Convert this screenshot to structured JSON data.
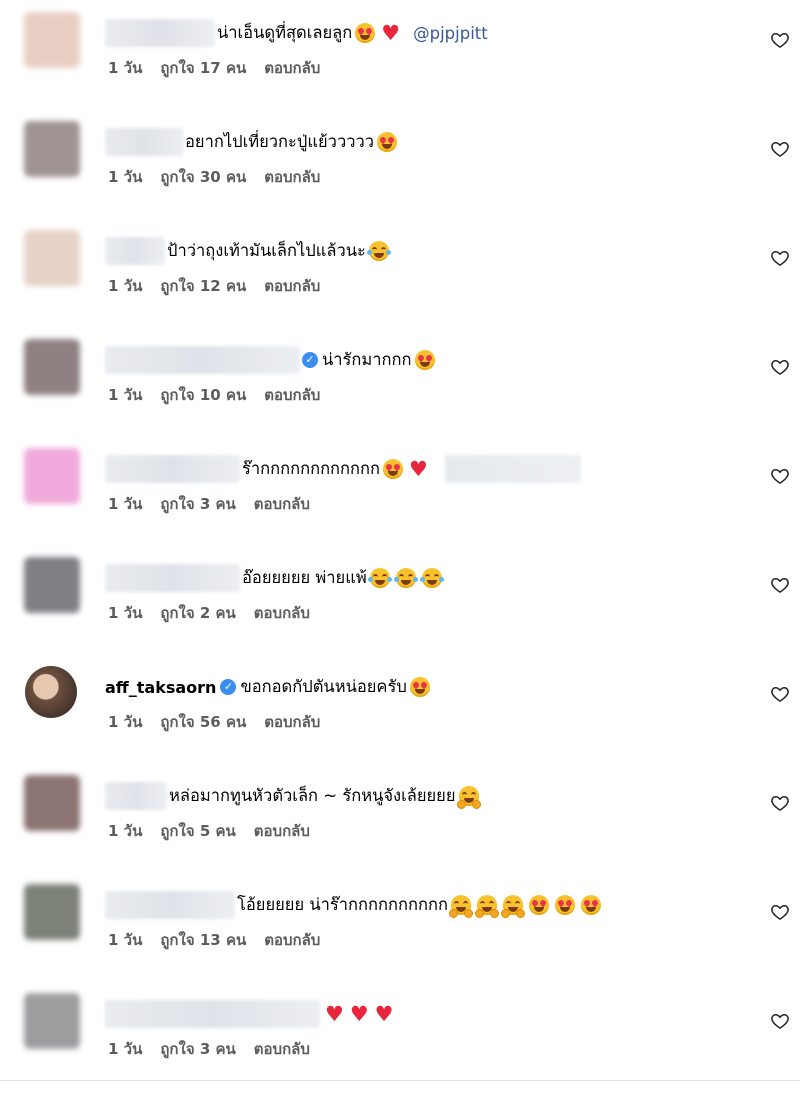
{
  "comments": [
    {
      "text": "น่าเอ็นดูที่สุดเลยลูก",
      "emojis": [
        "heart-eyes",
        "red-heart"
      ],
      "mention": "@pjpjpitt",
      "time": "1 วัน",
      "likes": "ถูกใจ 17 คน",
      "reply": "ตอบกลับ",
      "avatar_color": "#e9cfc3"
    },
    {
      "text": "อยากไปเที่ยวกะปู่แย้ววววว",
      "emojis": [
        "heart-eyes"
      ],
      "time": "1 วัน",
      "likes": "ถูกใจ 30 คน",
      "reply": "ตอบกลับ",
      "avatar_color": "#9f9491"
    },
    {
      "text": "ป้าว่าถุงเท้ามันเล็กไปแล้วนะ",
      "emojis": [
        "tears-of-joy"
      ],
      "time": "1 วัน",
      "likes": "ถูกใจ 12 คน",
      "reply": "ตอบกลับ",
      "avatar_color": "#e6d2c6"
    },
    {
      "text": "น่ารักมากกก",
      "emojis": [
        "heart-eyes"
      ],
      "verified": true,
      "time": "1 วัน",
      "likes": "ถูกใจ 10 คน",
      "reply": "ตอบกลับ",
      "avatar_color": "#8f8182"
    },
    {
      "text": "ร๊ากกกกกกกกกกกก",
      "emojis": [
        "heart-eyes",
        "red-heart"
      ],
      "tag_blur": true,
      "time": "1 วัน",
      "likes": "ถูกใจ 3 คน",
      "reply": "ตอบกลับ",
      "avatar_color": "#f0a9da"
    },
    {
      "text": "อ๊อยยยยย พ่ายแพ้",
      "emojis": [
        "tears-of-joy",
        "tears-of-joy",
        "tears-of-joy"
      ],
      "time": "1 วัน",
      "likes": "ถูกใจ 2 คน",
      "reply": "ตอบกลับ",
      "avatar_color": "#7f7f85"
    },
    {
      "username": "aff_taksaorn",
      "verified": true,
      "text": "ขอกอดกัปตันหน่อยครับ",
      "emojis": [
        "heart-eyes"
      ],
      "time": "1 วัน",
      "likes": "ถูกใจ 56 คน",
      "reply": "ตอบกลับ",
      "avatar_color": "#6b4f3e"
    },
    {
      "text": "หล่อมากทูนหัวตัวเล็ก ~ รักหนูจังเล้ยยยย",
      "emojis": [
        "hugging"
      ],
      "time": "1 วัน",
      "likes": "ถูกใจ 5 คน",
      "reply": "ตอบกลับ",
      "avatar_color": "#8c7473"
    },
    {
      "text": "โอ้ยยยยย น่าร๊ากกกกกกกกกก",
      "emojis": [
        "hugging",
        "hugging",
        "hugging",
        "heart-eyes",
        "heart-eyes",
        "heart-eyes"
      ],
      "time": "1 วัน",
      "likes": "ถูกใจ 13 คน",
      "reply": "ตอบกลับ",
      "avatar_color": "#7d8279"
    },
    {
      "text": "",
      "emojis": [
        "red-heart",
        "red-heart",
        "red-heart"
      ],
      "time": "1 วัน",
      "likes": "ถูกใจ 3 คน",
      "reply": "ตอบกลับ",
      "avatar_color": "#9d9d9f"
    }
  ],
  "icons": {
    "like": "heart-outline-icon",
    "verified": "verified-badge-icon"
  },
  "colors": {
    "mention": "#385898",
    "meta": "#5c5c5c",
    "heart": "#e8253a",
    "verified": "#3b8df0"
  }
}
